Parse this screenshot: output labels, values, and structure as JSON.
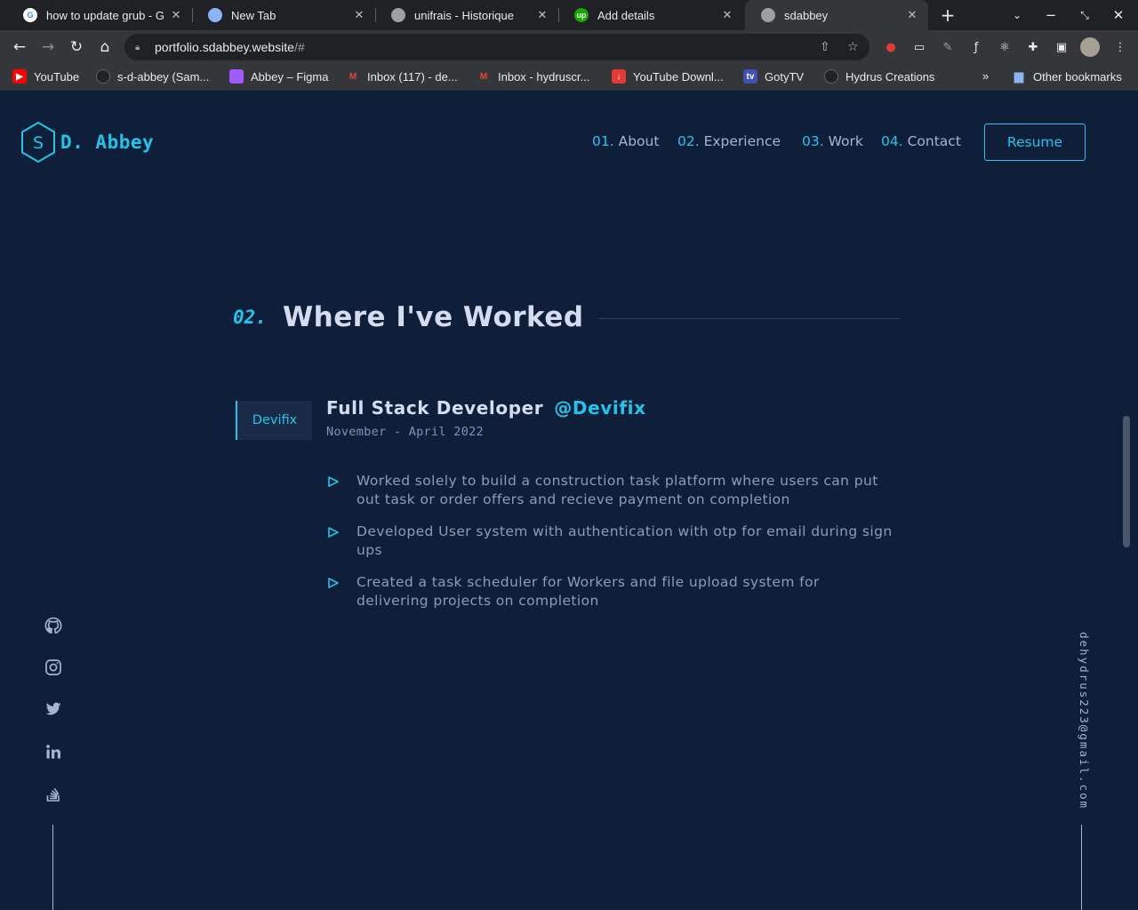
{
  "browser": {
    "tabs": [
      {
        "title": "how to update grub - G",
        "favicon": "google-icon",
        "color": "#ffffff"
      },
      {
        "title": "New Tab",
        "favicon": "chrome-icon",
        "color": "#5f6368"
      },
      {
        "title": "unifrais - Historique",
        "favicon": "globe-icon",
        "color": "#5f6368"
      },
      {
        "title": "Add details",
        "favicon": "upwork-icon",
        "color": "#14a800"
      },
      {
        "title": "sdabbey",
        "favicon": "globe-icon",
        "color": "#5f6368",
        "active": true
      }
    ],
    "url": {
      "host": "portfolio.sdabbey.website",
      "path": "/#"
    },
    "bookmarks": [
      {
        "label": "YouTube",
        "icon": "youtube-icon",
        "color": "#ff0000"
      },
      {
        "label": "s-d-abbey (Sam...",
        "icon": "github-icon",
        "color": "#202124"
      },
      {
        "label": "Abbey – Figma",
        "icon": "figma-icon",
        "color": "#a259ff"
      },
      {
        "label": "Inbox (117) - de...",
        "icon": "gmail-icon",
        "color": "#ea4335"
      },
      {
        "label": "Inbox - hydruscr...",
        "icon": "gmail-icon",
        "color": "#ea4335"
      },
      {
        "label": "YouTube Downl...",
        "icon": "download-icon",
        "color": "#e53935"
      },
      {
        "label": "GotyTV",
        "icon": "tv-icon",
        "color": "#3f51b5"
      },
      {
        "label": "Hydrus Creations",
        "icon": "github-icon",
        "color": "#202124"
      }
    ],
    "other_bookmarks": "Other bookmarks"
  },
  "site": {
    "logo_letter": "S",
    "logo_text": "D. Abbey",
    "nav": [
      {
        "num": "01.",
        "label": "About"
      },
      {
        "num": "02.",
        "label": "Experience"
      },
      {
        "num": "03.",
        "label": "Work"
      },
      {
        "num": "04.",
        "label": "Contact"
      }
    ],
    "resume": "Resume",
    "section": {
      "num": "02.",
      "title": "Where I've Worked"
    },
    "companies": [
      "Devifix"
    ],
    "job": {
      "title": "Full Stack Developer",
      "company": "@Devifix",
      "date": "November - April 2022",
      "duties": [
        "Worked solely to build a construction task platform where users can put out task or order offers and recieve payment on completion",
        "Developed User system with authentication with otp for email during sign ups",
        "Created a task scheduler for Workers and file upload system for delivering projects on completion"
      ]
    },
    "socials": [
      "github-icon",
      "instagram-icon",
      "twitter-icon",
      "linkedin-icon",
      "stackoverflow-icon"
    ],
    "email": "dehydrus223@gmail.com",
    "accent": "#1fc6ea",
    "background": "#0f1f3a"
  }
}
